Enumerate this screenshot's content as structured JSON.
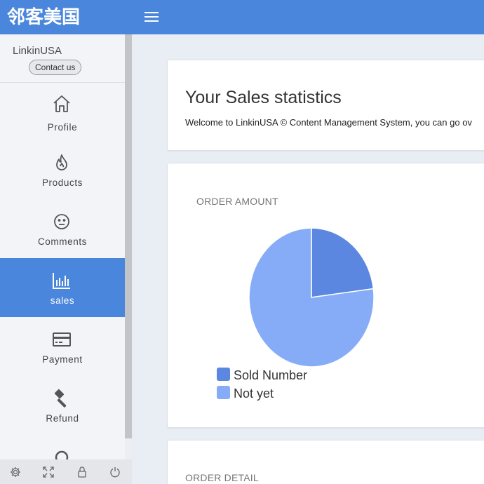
{
  "header": {
    "logo_text": "邻客美国"
  },
  "sidebar": {
    "user_name": "LinkinUSA",
    "contact_label": "Contact us",
    "items": [
      {
        "label": "Profile",
        "icon": "home-icon",
        "active": false
      },
      {
        "label": "Products",
        "icon": "flame-icon",
        "active": false
      },
      {
        "label": "Comments",
        "icon": "face-icon",
        "active": false
      },
      {
        "label": "sales",
        "icon": "bar-chart-icon",
        "active": true
      },
      {
        "label": "Payment",
        "icon": "credit-card-icon",
        "active": false
      },
      {
        "label": "Refund",
        "icon": "gavel-icon",
        "active": false
      }
    ],
    "bottom_icons": [
      "gear-icon",
      "expand-icon",
      "lock-icon",
      "power-icon"
    ]
  },
  "main": {
    "title": "Your Sales statistics",
    "description": "Welcome to LinkinUSA © Content Management System, you can go ov",
    "order_amount_label": "ORDER AMOUNT",
    "order_detail_label": "ORDER DETAIL"
  },
  "chart_data": {
    "type": "pie",
    "title": "ORDER AMOUNT",
    "slices": [
      {
        "name": "Sold Number",
        "value": 23,
        "color": "#5b87e0"
      },
      {
        "name": "Not yet",
        "value": 77,
        "color": "#87acf7"
      }
    ],
    "legend_position": "bottom-left"
  },
  "colors": {
    "accent": "#4a86db",
    "sidebar_bg": "#f2f4f8",
    "page_bg": "#e9edf4"
  }
}
